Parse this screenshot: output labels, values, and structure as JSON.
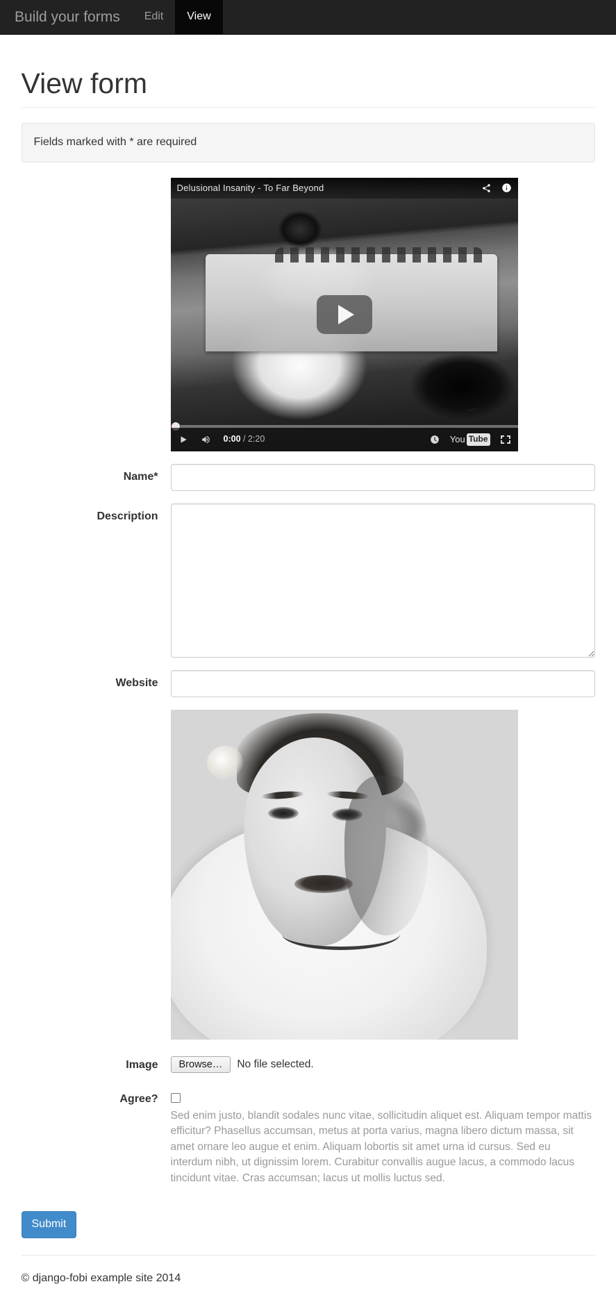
{
  "navbar": {
    "brand": "Build your forms",
    "items": [
      {
        "label": "Edit",
        "active": false
      },
      {
        "label": "View",
        "active": true
      }
    ],
    "background_color": "#222222",
    "active_background_color": "#080808"
  },
  "page": {
    "title": "View form",
    "alert": "Fields marked with * are required"
  },
  "video": {
    "title": "Delusional Insanity - To Far Beyond",
    "current_time": "0:00",
    "separator": "/",
    "duration": "2:20",
    "logo_you": "You",
    "logo_tube": "Tube",
    "icons": {
      "share": "share-icon",
      "info": "info-icon",
      "play": "play-icon",
      "volume": "volume-icon",
      "watch_later": "clock-icon",
      "fullscreen": "fullscreen-icon"
    }
  },
  "form": {
    "fields": {
      "name": {
        "label": "Name*",
        "value": "",
        "placeholder": ""
      },
      "description": {
        "label": "Description",
        "value": "",
        "placeholder": ""
      },
      "website": {
        "label": "Website",
        "value": "",
        "placeholder": ""
      },
      "image": {
        "label": "Image",
        "browse_label": "Browse…",
        "status": "No file selected."
      },
      "agree": {
        "label": "Agree?",
        "checked": false,
        "help": "Sed enim justo, blandit sodales nunc vitae, sollicitudin aliquet est. Aliquam tempor mattis efficitur? Phasellus accumsan, metus at porta varius, magna libero dictum massa, sit amet ornare leo augue et enim. Aliquam lobortis sit amet urna id cursus. Sed eu interdum nibh, ut dignissim lorem. Curabitur convallis augue lacus, a commodo lacus tincidunt vitae. Cras accumsan; lacus ut mollis luctus sed."
      }
    },
    "submit_label": "Submit",
    "submit_color": "#428bca"
  },
  "footer": {
    "copyright": "© django-fobi example site 2014"
  }
}
